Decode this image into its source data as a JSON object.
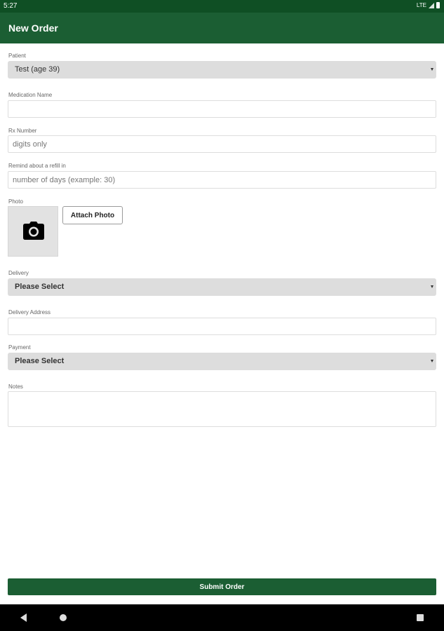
{
  "status_bar": {
    "time": "5:27",
    "network": "LTE"
  },
  "app_bar": {
    "title": "New Order"
  },
  "form": {
    "patient": {
      "label": "Patient",
      "selected": "Test (age 39)"
    },
    "medication_name": {
      "label": "Medication Name",
      "value": "",
      "placeholder": ""
    },
    "rx_number": {
      "label": "Rx Number",
      "value": "",
      "placeholder": "digits only"
    },
    "refill_reminder": {
      "label": "Remind about a refill in",
      "value": "",
      "placeholder": "number of days (example: 30)"
    },
    "photo": {
      "label": "Photo",
      "icon": "camera-icon",
      "attach_label": "Attach Photo"
    },
    "delivery": {
      "label": "Delivery",
      "selected": "Please Select"
    },
    "delivery_address": {
      "label": "Delivery Address",
      "value": "",
      "placeholder": ""
    },
    "payment": {
      "label": "Payment",
      "selected": "Please Select"
    },
    "notes": {
      "label": "Notes",
      "value": ""
    },
    "submit_label": "Submit Order"
  },
  "colors": {
    "status_bar": "#0f4f24",
    "app_bar": "#1b5e33",
    "submit_button": "#1b5e33",
    "select_background": "#dddddd"
  },
  "nav_bar": {
    "back_icon": "back-triangle-icon",
    "home_icon": "home-circle-icon",
    "recents_icon": "recents-square-icon"
  }
}
